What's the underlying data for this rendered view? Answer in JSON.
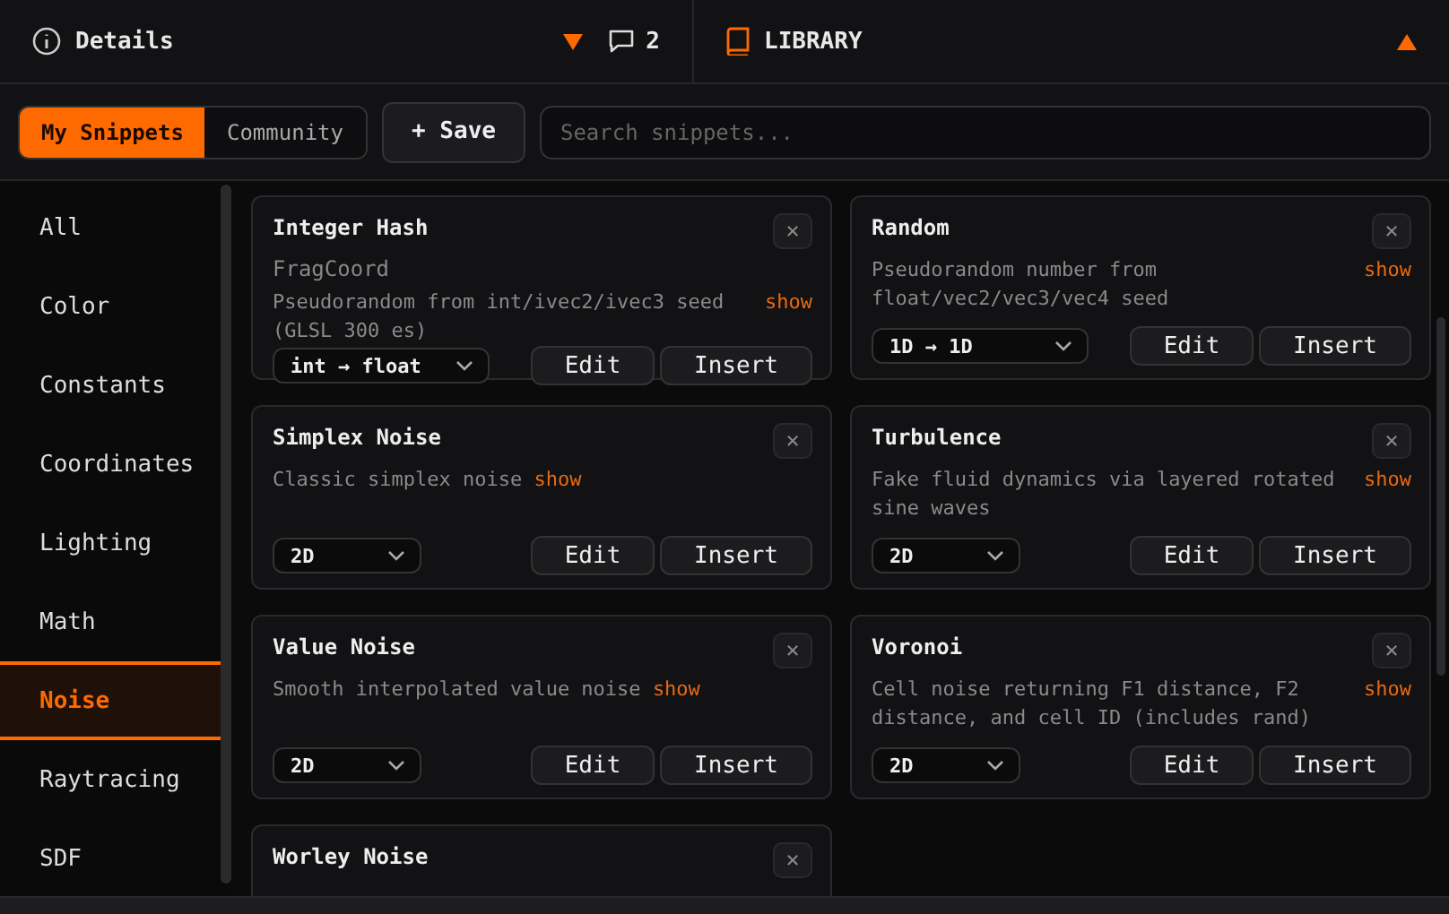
{
  "header": {
    "details": {
      "label": "Details",
      "expanded": false
    },
    "comments": {
      "count": "2"
    },
    "library": {
      "label": "LIBRARY",
      "expanded": true
    }
  },
  "toolbar": {
    "tabs": [
      {
        "label": "My Snippets",
        "selected": true
      },
      {
        "label": "Community",
        "selected": false
      }
    ],
    "save_button": "+ Save",
    "search": {
      "placeholder": "Search snippets..."
    }
  },
  "sidebar": {
    "items": [
      {
        "label": "All",
        "selected": false
      },
      {
        "label": "Color",
        "selected": false
      },
      {
        "label": "Constants",
        "selected": false
      },
      {
        "label": "Coordinates",
        "selected": false
      },
      {
        "label": "Lighting",
        "selected": false
      },
      {
        "label": "Math",
        "selected": false
      },
      {
        "label": "Noise",
        "selected": true
      },
      {
        "label": "Raytracing",
        "selected": false
      },
      {
        "label": "SDF",
        "selected": false
      }
    ]
  },
  "snippets": [
    {
      "title": "Integer Hash",
      "subtitle": "FragCoord",
      "description": "Pseudorandom from int/ivec2/ivec3 seed (GLSL 300 es)",
      "link": "show",
      "variant": "int → float",
      "edit": "Edit",
      "insert": "Insert",
      "close": "×"
    },
    {
      "title": "Random",
      "description": "Pseudorandom number from float/vec2/vec3/vec4 seed",
      "link": "show",
      "variant": "1D → 1D",
      "edit": "Edit",
      "insert": "Insert",
      "close": "×"
    },
    {
      "title": "Simplex Noise",
      "description": "Classic simplex noise",
      "link": "show",
      "inline_link": true,
      "variant": "2D",
      "edit": "Edit",
      "insert": "Insert",
      "close": "×"
    },
    {
      "title": "Turbulence",
      "description": "Fake fluid dynamics via layered rotated sine waves",
      "link": "show",
      "variant": "2D",
      "edit": "Edit",
      "insert": "Insert",
      "close": "×"
    },
    {
      "title": "Value Noise",
      "description": "Smooth interpolated value noise",
      "link": "show",
      "inline_link": true,
      "variant": "2D",
      "edit": "Edit",
      "insert": "Insert",
      "close": "×"
    },
    {
      "title": "Voronoi",
      "description": "Cell noise returning F1 distance, F2 distance, and cell ID (includes rand)",
      "link": "show",
      "variant": "2D",
      "edit": "Edit",
      "insert": "Insert",
      "close": "×"
    },
    {
      "title": "Worley Noise",
      "close": "×"
    }
  ]
}
